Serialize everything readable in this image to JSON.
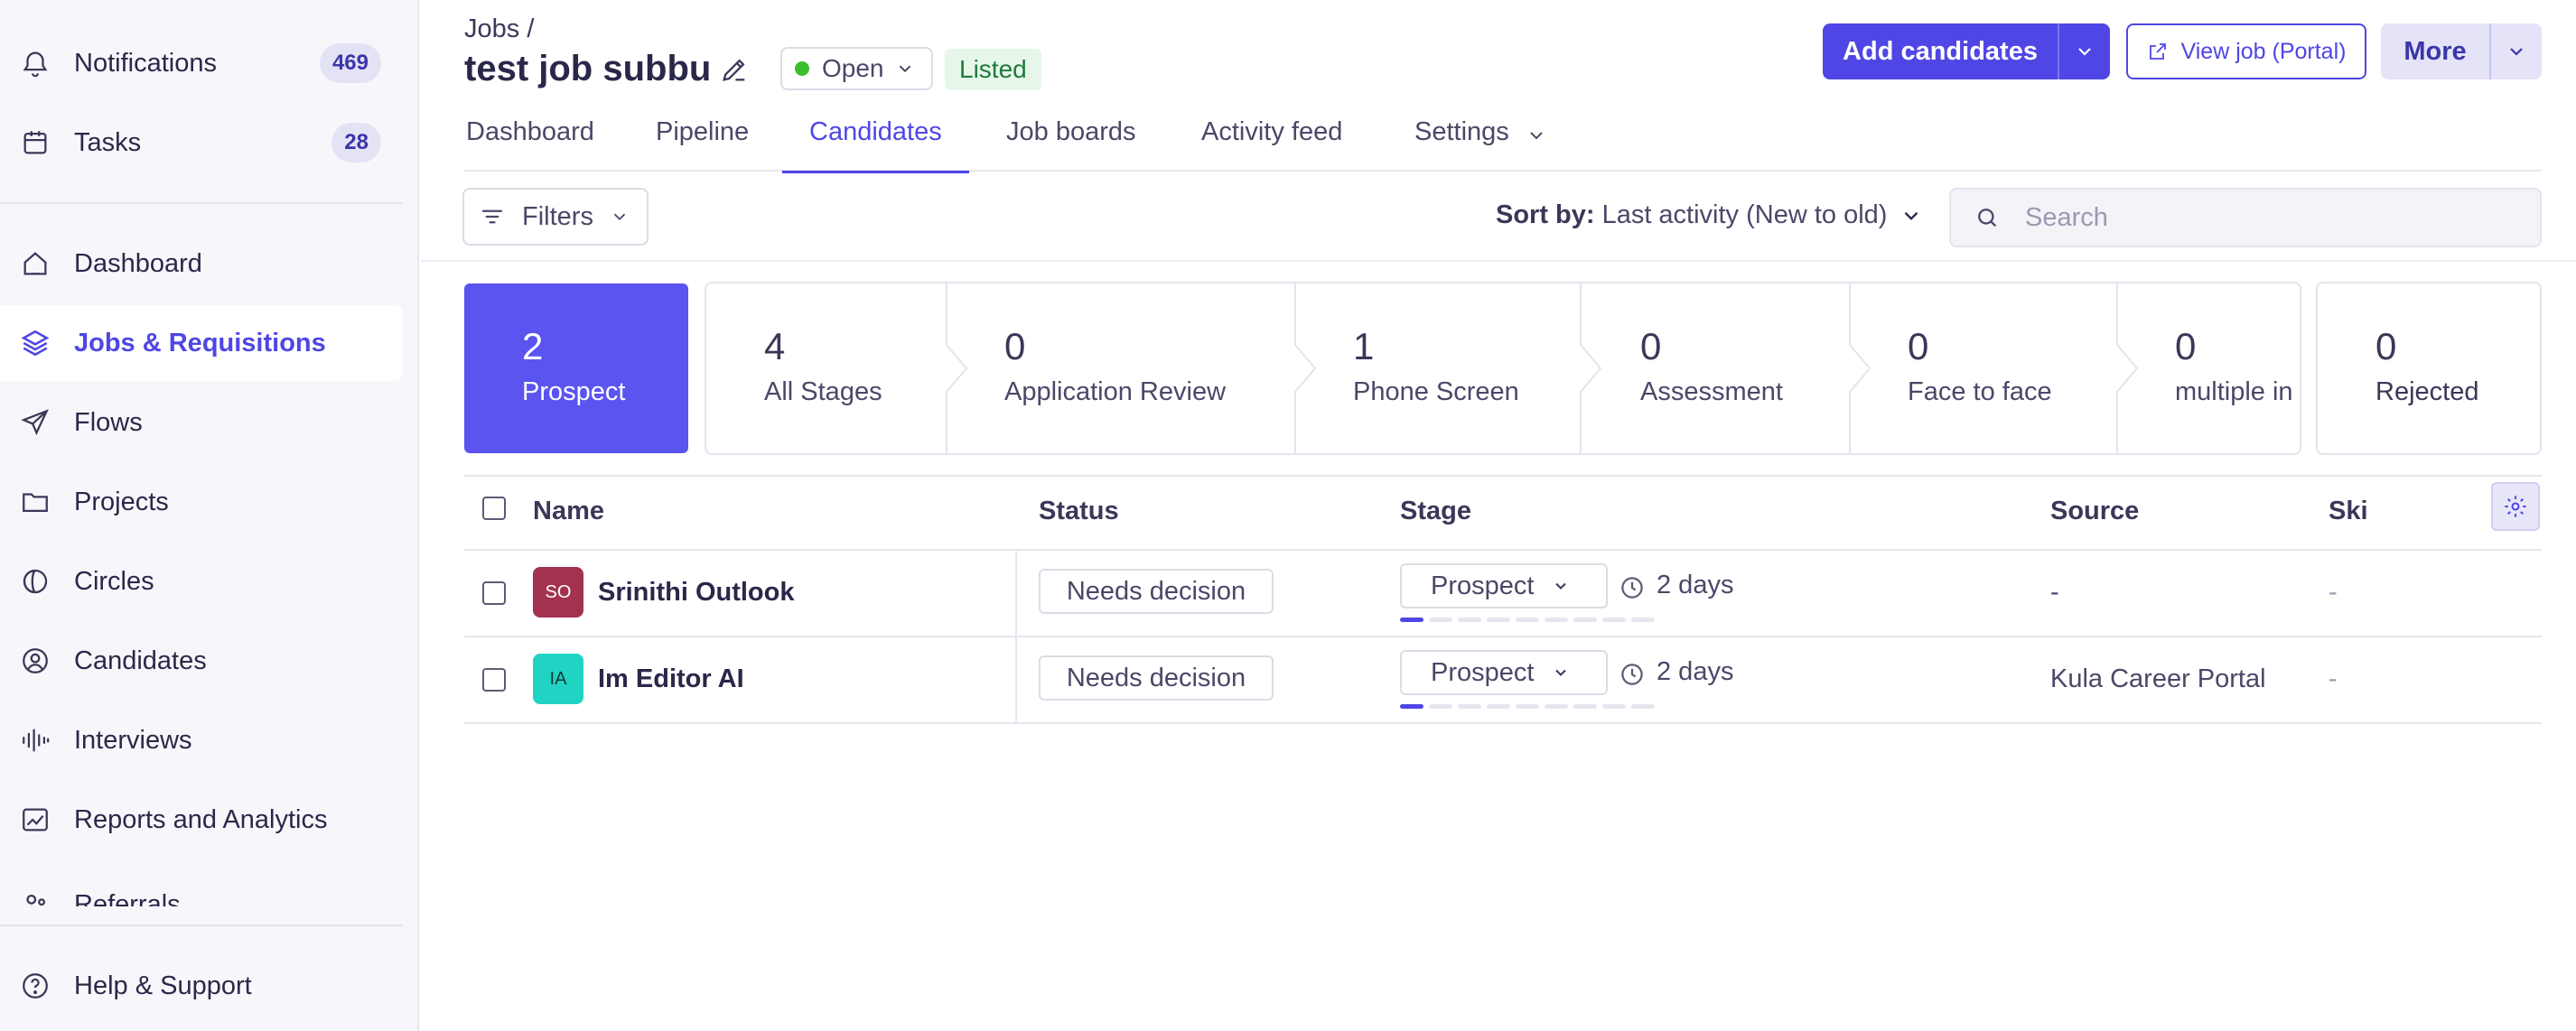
{
  "sidebar": {
    "notifications": {
      "label": "Notifications",
      "badge": "469"
    },
    "tasks": {
      "label": "Tasks",
      "badge": "28"
    },
    "items": [
      {
        "label": "Dashboard",
        "icon": "home-icon"
      },
      {
        "label": "Jobs & Requisitions",
        "icon": "layers-icon",
        "active": true
      },
      {
        "label": "Flows",
        "icon": "send-icon"
      },
      {
        "label": "Projects",
        "icon": "folder-icon"
      },
      {
        "label": "Circles",
        "icon": "circles-icon"
      },
      {
        "label": "Candidates",
        "icon": "user-circle-icon"
      },
      {
        "label": "Interviews",
        "icon": "waveform-icon"
      },
      {
        "label": "Reports and Analytics",
        "icon": "chart-icon"
      },
      {
        "label": "Referrals",
        "icon": "referrals-icon"
      }
    ],
    "help": {
      "label": "Help & Support",
      "icon": "help-circle-icon"
    }
  },
  "header": {
    "breadcrumb": "Jobs /",
    "title": "test job subbu",
    "status": "Open",
    "listed": "Listed",
    "add_candidates": "Add candidates",
    "view_job": "View job (Portal)",
    "more": "More"
  },
  "tabs": [
    "Dashboard",
    "Pipeline",
    "Candidates",
    "Job boards",
    "Activity feed",
    "Settings"
  ],
  "active_tab": "Candidates",
  "toolbar": {
    "filters": "Filters",
    "sort_label": "Sort by:",
    "sort_value": "Last activity (New to old)",
    "search_placeholder": "Search"
  },
  "stages": {
    "prospect": {
      "count": "2",
      "label": "Prospect"
    },
    "pipeline": [
      {
        "count": "4",
        "label": "All Stages"
      },
      {
        "count": "0",
        "label": "Application Review"
      },
      {
        "count": "1",
        "label": "Phone Screen"
      },
      {
        "count": "0",
        "label": "Assessment"
      },
      {
        "count": "0",
        "label": "Face to face"
      },
      {
        "count": "0",
        "label": "multiple in"
      }
    ],
    "rejected": {
      "count": "0",
      "label": "Rejected"
    }
  },
  "table": {
    "columns": [
      "Name",
      "Status",
      "Stage",
      "Source",
      "Ski"
    ],
    "rows": [
      {
        "initials": "SO",
        "avatar_color": "#a3324f",
        "name": "Srinithi Outlook",
        "status": "Needs decision",
        "stage": "Prospect",
        "time": "2 days",
        "source": "-",
        "skills": "-"
      },
      {
        "initials": "IA",
        "avatar_color": "#21d3c3",
        "name": "Im Editor AI",
        "status": "Needs decision",
        "stage": "Prospect",
        "time": "2 days",
        "source": "Kula Career Portal",
        "skills": "-"
      }
    ]
  },
  "colors": {
    "accent": "#4f46e5",
    "prospect_card": "#5b54f0",
    "open_dot": "#3cbf2e",
    "listed_bg": "#e6f7ea"
  }
}
